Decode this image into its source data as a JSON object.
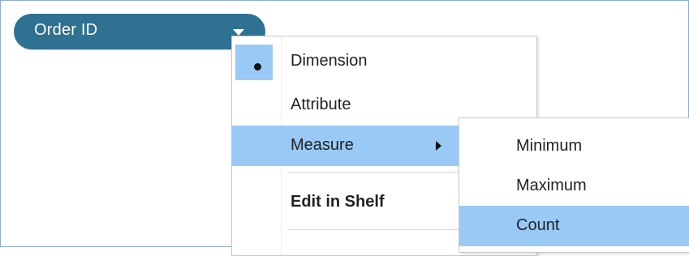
{
  "pill": {
    "label": "Order ID"
  },
  "menu": {
    "items": [
      {
        "label": "Dimension",
        "checked": true
      },
      {
        "label": "Attribute"
      },
      {
        "label": "Measure",
        "has_submenu": true,
        "highlighted": true
      },
      {
        "label": "Edit in Shelf",
        "bold": true
      }
    ]
  },
  "submenu": {
    "items": [
      {
        "label": "Minimum"
      },
      {
        "label": "Maximum"
      },
      {
        "label": "Count",
        "highlighted": true
      }
    ]
  },
  "colors": {
    "pill_background": "#2f7190",
    "highlight": "#99c9f5",
    "frame_border": "#8faed2"
  }
}
